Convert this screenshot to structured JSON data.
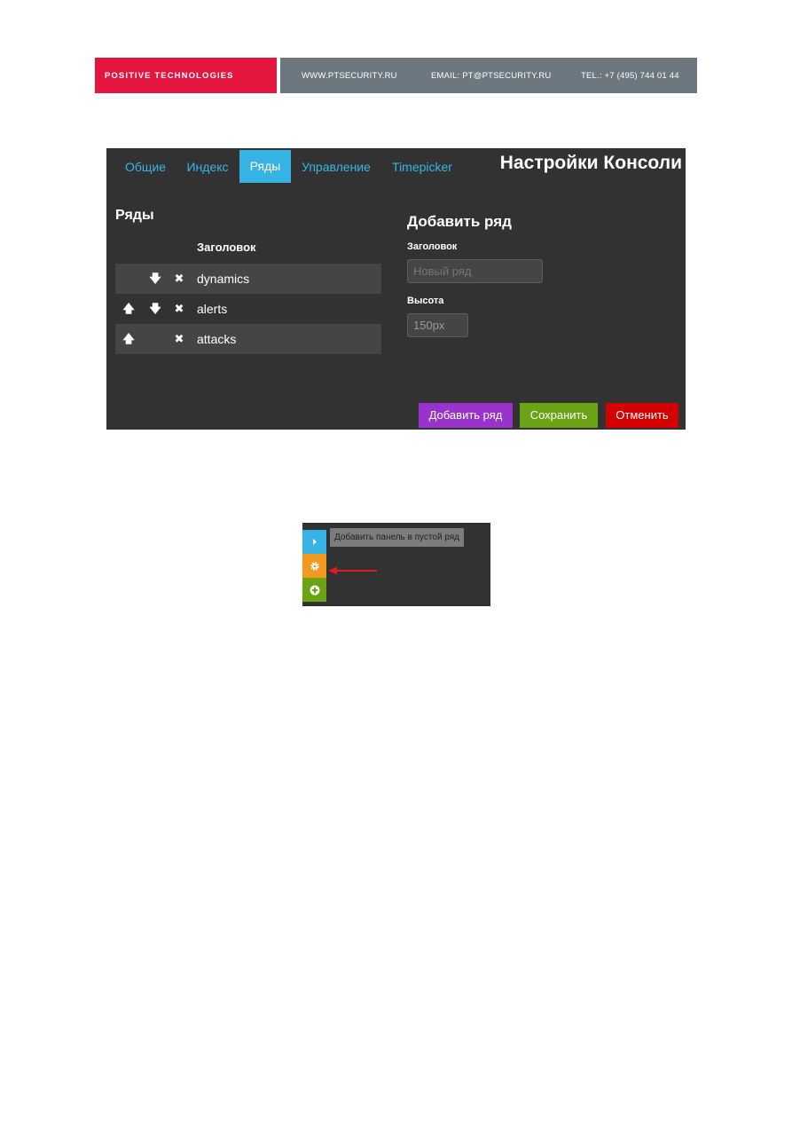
{
  "banner": {
    "company": "POSITIVE TECHNOLOGIES",
    "website": "WWW.PTSECURITY.RU",
    "email": "EMAIL: PT@PTSECURITY.RU",
    "phone": "TEL.: +7 (495) 744 01 44"
  },
  "console": {
    "title": "Настройки Консоли",
    "tabs": [
      {
        "label": "Общие",
        "active": false
      },
      {
        "label": "Индекс",
        "active": false
      },
      {
        "label": "Ряды",
        "active": true
      },
      {
        "label": "Управление",
        "active": false
      },
      {
        "label": "Timepicker",
        "active": false
      }
    ],
    "rows_section": {
      "title": "Ряды",
      "column_header": "Заголовок",
      "rows": [
        {
          "name": "dynamics",
          "up": false,
          "down": true,
          "remove": true
        },
        {
          "name": "alerts",
          "up": true,
          "down": true,
          "remove": true
        },
        {
          "name": "attacks",
          "up": true,
          "down": false,
          "remove": true
        }
      ]
    },
    "add_row": {
      "title": "Добавить ряд",
      "title_label": "Заголовок",
      "title_placeholder": "Новый ряд",
      "height_label": "Высота",
      "height_value": "150px"
    },
    "buttons": {
      "add_row": "Добавить ряд",
      "save": "Сохранить",
      "cancel": "Отменить"
    }
  },
  "sidebar_mini": {
    "tooltip": "Добавить панель в пустой ряд",
    "buttons": [
      {
        "icon": "caret-right-icon",
        "color": "#36b2e5"
      },
      {
        "icon": "gear-icon",
        "color": "#f39a1e"
      },
      {
        "icon": "plus-circle-icon",
        "color": "#6aa313"
      }
    ],
    "arrow_color": "#e11b22"
  },
  "colors": {
    "brand_red": "#e4163f",
    "banner_grey": "#6c7780",
    "panel_bg": "#323232",
    "accent_blue": "#36b2e5",
    "btn_purple": "#9933cc",
    "btn_green": "#6aa313",
    "btn_red": "#d50000"
  }
}
